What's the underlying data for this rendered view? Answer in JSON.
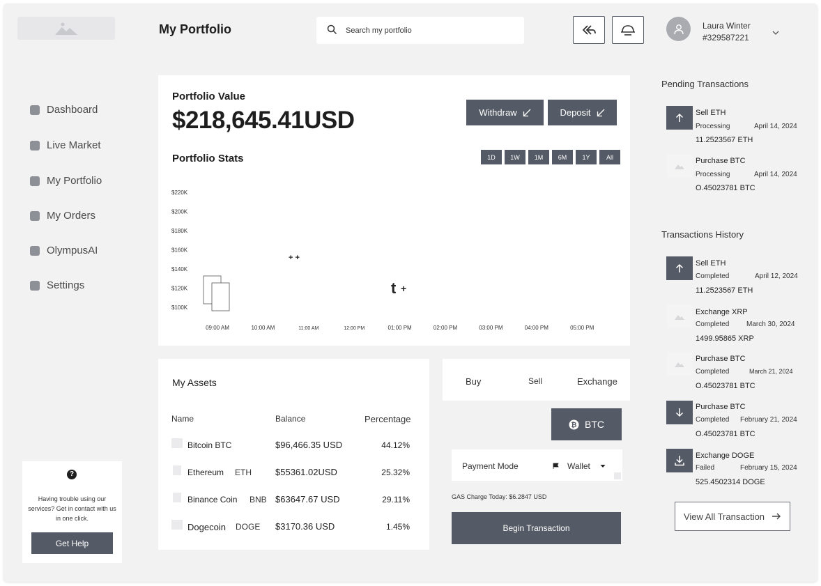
{
  "header": {
    "page_title": "My Portfolio",
    "search_placeholder": "Search my portfolio",
    "user": {
      "name": "Laura Winter",
      "id": "#329587221"
    }
  },
  "sidebar": {
    "items": [
      {
        "label": "Dashboard"
      },
      {
        "label": "Live Market"
      },
      {
        "label": "My Portfolio"
      },
      {
        "label": "My Orders"
      },
      {
        "label": "OlympusAI"
      },
      {
        "label": "Settings"
      }
    ],
    "help": {
      "icon": "?",
      "text": "Having trouble using our services? Get in contact with us in one click.",
      "button": "Get Help"
    }
  },
  "portfolio": {
    "value_label": "Portfolio Value",
    "value": "$218,645.41USD",
    "withdraw_label": "Withdraw",
    "deposit_label": "Deposit",
    "stats_label": "Portfolio Stats",
    "ranges": [
      "1D",
      "1W",
      "1M",
      "6M",
      "1Y",
      "All"
    ]
  },
  "chart_data": {
    "type": "line",
    "y_ticks": [
      "$220K",
      "$200K",
      "$180K",
      "$160K",
      "$140K",
      "$120K",
      "$100K"
    ],
    "x_ticks": [
      "09:00 AM",
      "10:00 AM",
      "11:00 AM",
      "12:00 PM",
      "01:00 PM",
      "02:00 PM",
      "03:00 PM",
      "04:00 PM",
      "05:00 PM"
    ],
    "ylim": [
      100000,
      220000
    ],
    "series": []
  },
  "assets": {
    "title": "My Assets",
    "columns": [
      "Name",
      "Balance",
      "Percentage"
    ],
    "rows": [
      {
        "name": "Bitcoin BTC",
        "ticker": "",
        "balance": "$96,466.35 USD",
        "pct": "44.12%"
      },
      {
        "name": "Ethereum",
        "ticker": "ETH",
        "balance": "$55361.02USD",
        "pct": "25.32%"
      },
      {
        "name": "Binance Coin",
        "ticker": "BNB",
        "balance": "$63647.67 USD",
        "pct": "29.11%"
      },
      {
        "name": "Dogecoin",
        "ticker": "DOGE",
        "balance": "$3170.36 USD",
        "pct": "1.45%"
      }
    ]
  },
  "trade": {
    "tabs": [
      "Buy",
      "Sell",
      "Exchange"
    ],
    "coin_label": "BTC",
    "payment_mode_label": "Payment Mode",
    "payment_mode_value": "Wallet",
    "gas": "GAS Charge Today: $6.2847 USD",
    "begin_label": "Begin Transaction"
  },
  "pending": {
    "title": "Pending Transactions",
    "items": [
      {
        "title": "Sell ETH",
        "status": "Processing",
        "date": "April 14, 2024",
        "amount": "11.2523567 ETH",
        "icon": "arrow-up-icon"
      },
      {
        "title": "Purchase BTC",
        "status": "Processing",
        "date": "April 14, 2024",
        "amount": "O.45023781 BTC",
        "icon": "image-placeholder-icon"
      }
    ]
  },
  "history": {
    "title": "Transactions History",
    "items": [
      {
        "title": "Sell ETH",
        "status": "Completed",
        "date": "April 12, 2024",
        "amount": "11.2523567 ETH",
        "icon": "arrow-up-icon"
      },
      {
        "title": "Exchange XRP",
        "status": "Completed",
        "date": "March 30, 2024",
        "amount": "1499.95865 XRP",
        "icon": "image-placeholder-icon"
      },
      {
        "title": "Purchase BTC",
        "status": "Completed",
        "date": "March 21, 2024",
        "amount": "O.45023781 BTC",
        "icon": "image-placeholder-icon"
      },
      {
        "title": "Purchase BTC",
        "status": "Completed",
        "date": "February 21, 2024",
        "amount": "O.45023781 BTC",
        "icon": "arrow-down-icon"
      },
      {
        "title": "Exchange DOGE",
        "status": "Failed",
        "date": "February 15, 2024",
        "amount": "525.4502314 DOGE",
        "icon": "download-icon"
      }
    ],
    "view_all_label": "View All Transaction"
  }
}
